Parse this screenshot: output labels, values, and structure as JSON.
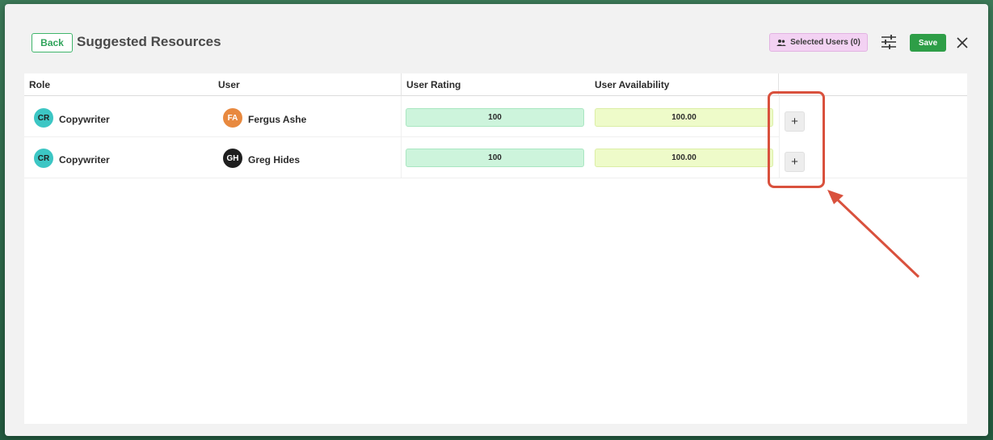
{
  "header": {
    "back_label": "Back",
    "title": "Suggested Resources",
    "selected_users_label": "Selected Users (0)",
    "save_label": "Save"
  },
  "table": {
    "columns": [
      "Role",
      "User",
      "User Rating",
      "User Availability"
    ],
    "rows": [
      {
        "role_initials": "CR",
        "role": "Copywriter",
        "user_initials": "FA",
        "user": "Fergus Ashe",
        "rating": "100",
        "availability": "100.00",
        "add_label": "+"
      },
      {
        "role_initials": "CR",
        "role": "Copywriter",
        "user_initials": "GH",
        "user": "Greg Hides",
        "rating": "100",
        "availability": "100.00",
        "add_label": "+"
      }
    ]
  },
  "colors": {
    "role_avatar": "#3cc6c4",
    "fergus_avatar": "#e8893f",
    "greg_avatar": "#1f1f1f",
    "save": "#2e9e47",
    "annotation": "#d9513d"
  },
  "icons": {
    "selected_users": "people-icon",
    "filter": "sliders-icon",
    "close": "close-icon"
  }
}
